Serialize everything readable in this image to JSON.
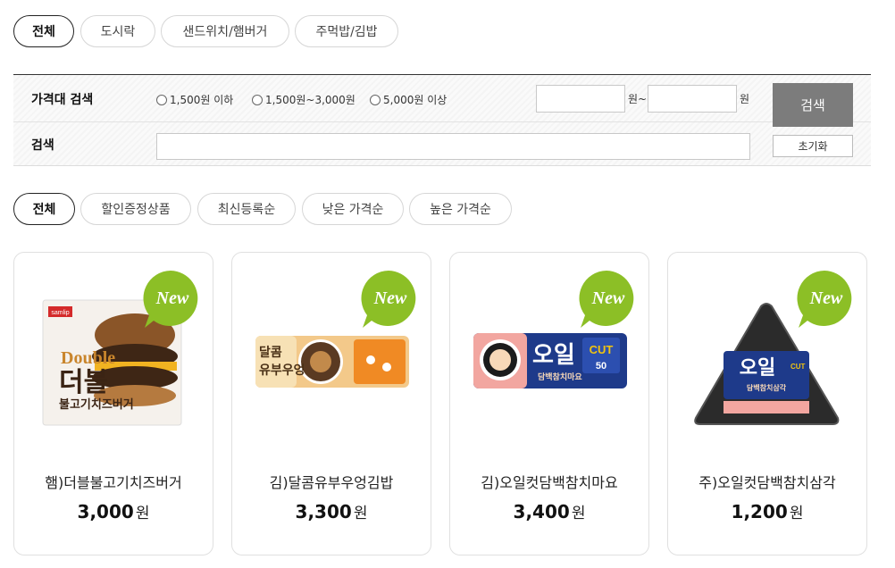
{
  "category_tabs": [
    "전체",
    "도시락",
    "샌드위치/햄버거",
    "주먹밥/김밥"
  ],
  "search_panel": {
    "price_label": "가격대 검색",
    "price_options": [
      "1,500원 이하",
      "1,500원~3,000원",
      "5,000원 이상"
    ],
    "range_from_unit": "원~",
    "range_to_unit": "원",
    "keyword_label": "검색",
    "search_button": "검색",
    "reset_button": "초기화"
  },
  "sort_tabs": [
    "전체",
    "할인증정상품",
    "최신등록순",
    "낮은 가격순",
    "높은 가격순"
  ],
  "badge_text": "New",
  "products": [
    {
      "name": "햄)더블불고기치즈버거",
      "price": "3,000",
      "currency": "원",
      "package_text": [
        "samlip",
        "Double",
        "더블",
        "불고기치즈버거"
      ]
    },
    {
      "name": "김)달콤유부우엉김밥",
      "price": "3,300",
      "currency": "원",
      "package_text": [
        "달콤",
        "유부우엉"
      ]
    },
    {
      "name": "김)오일컷담백참치마요",
      "price": "3,400",
      "currency": "원",
      "package_text": [
        "오일",
        "CUT",
        "담백참치마요",
        "50"
      ]
    },
    {
      "name": "주)오일컷담백참치삼각",
      "price": "1,200",
      "currency": "원",
      "package_text": [
        "오일",
        "CUT",
        "담백참치삼각"
      ]
    }
  ],
  "colors": {
    "badge_green": "#8cbf26",
    "search_button": "#7c7c7c",
    "active_border": "#222222"
  }
}
